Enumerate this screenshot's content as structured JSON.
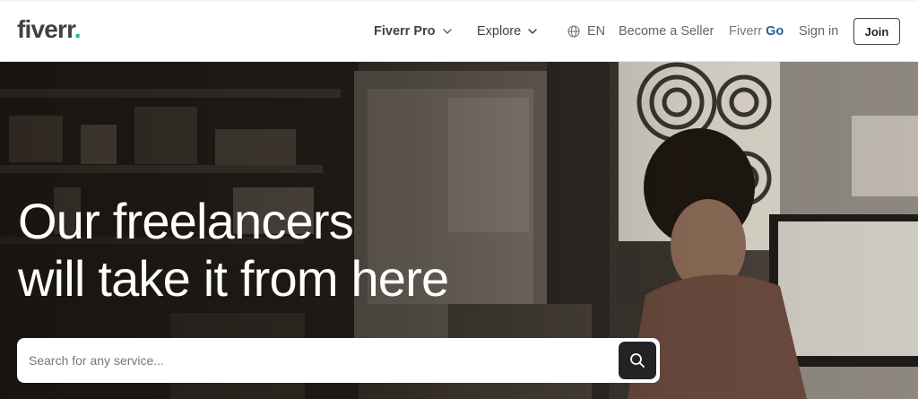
{
  "header": {
    "logo_text": "fiverr",
    "logo_dot": ".",
    "nav": {
      "fiverr_pro": "Fiverr Pro",
      "explore": "Explore",
      "language": "EN",
      "become_seller": "Become a Seller",
      "fiverr_go_prefix": "Fiverr",
      "fiverr_go_suffix": " Go",
      "sign_in": "Sign in",
      "join": "Join"
    }
  },
  "hero": {
    "headline_line1": "Our freelancers",
    "headline_line2": "will take it from here",
    "search": {
      "placeholder": "Search for any service..."
    }
  },
  "colors": {
    "brand_green": "#1dbf73",
    "logo_text": "#404145",
    "go_blue": "#2d5f9a",
    "search_button": "#222325"
  },
  "icons": [
    "chevron-down-icon",
    "globe-icon",
    "search-icon"
  ]
}
